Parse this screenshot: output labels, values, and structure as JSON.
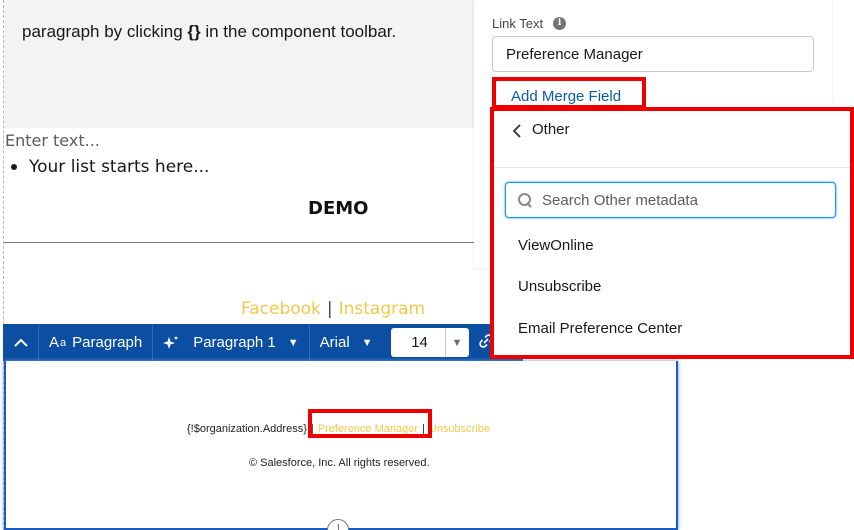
{
  "canvas": {
    "paragraph_text_before": "paragraph by clicking ",
    "paragraph_text_code": "{}",
    "paragraph_text_after": " in the component toolbar.",
    "enter_text_placeholder": "Enter text...",
    "list_item": "Your list starts here...",
    "demo_heading": "DEMO",
    "social": {
      "facebook": "Facebook",
      "separator": "|",
      "instagram": "Instagram"
    }
  },
  "toolbar": {
    "collapse_icon": "chevron-up-icon",
    "style_label": "Paragraph",
    "style_icon": "text-style-icon",
    "ai_icon": "sparkle-icon",
    "paragraph_variant": "Paragraph 1",
    "font_family": "Arial",
    "font_size": "14",
    "link_icon": "link-icon"
  },
  "footer": {
    "address": "{!$organization.Address}",
    "separator": "|",
    "preference_manager": "Preference Manager",
    "unsubscribe": "Unsubscribe",
    "copyright": "© Salesforce, Inc. All rights reserved."
  },
  "panel": {
    "link_text_label": "Link Text",
    "link_text_value": "Preference Manager",
    "add_merge_field": "Add Merge Field"
  },
  "dropdown": {
    "title": "Other",
    "search_placeholder": "Search Other metadata",
    "items": [
      "ViewOnline",
      "Unsubscribe",
      "Email Preference Center"
    ]
  },
  "colors": {
    "toolbar_bg": "#0b4ea2",
    "highlight_red": "#ee0000",
    "link_blue": "#0b5cab",
    "social_yellow": "#f2c94c"
  }
}
